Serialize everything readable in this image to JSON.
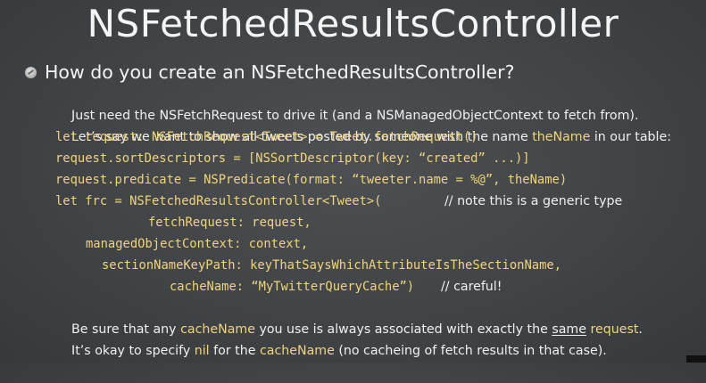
{
  "title": "NSFetchedResultsController",
  "bullet": "How do you create an NSFetchedResultsController?",
  "p1": {
    "a": "Just need the NSFetchRequest to drive it (and a NSManagedObjectContext to fetch from)."
  },
  "p2": {
    "a": "Let’s say we want to show all tweets posted by someone with the name ",
    "b": "theName",
    "c": " in our table:"
  },
  "code": {
    "l1": "let request: NSFetchRequest<Tweet> = Tweet.fetchRequest()",
    "l2": "request.sortDescriptors = [NSSortDescriptor(key: “created” ...)]",
    "l3": "request.predicate = NSPredicate(format: “tweeter.name = %@”, theName)",
    "l4": "let frc = NSFetchedResultsController<Tweet>(",
    "l4_comment": "// note this is a generic type",
    "l5": "fetchRequest: request,",
    "l6": "managedObjectContext: context,",
    "l7": "sectionNameKeyPath: keyThatSaysWhichAttributeIsTheSectionName,",
    "l8": "cacheName: “MyTwitterQueryCache”)",
    "l8_comment": "// careful!"
  },
  "p3": {
    "a": "Be sure that any ",
    "b": "cacheName",
    "c": " you use is always associated with exactly the ",
    "d": "same",
    "e": " ",
    "f": "request",
    "g": "."
  },
  "p4": {
    "a": "It’s okay to specify ",
    "b": "nil",
    "c": " for the ",
    "d": "cacheName",
    "e": " (no cacheing of fetch results in that case)."
  },
  "colors": {
    "background": "#424547",
    "code": "#f1d47a",
    "text": "#f0f0f0"
  },
  "icons": {
    "bullet": "bullet-disc-icon"
  }
}
